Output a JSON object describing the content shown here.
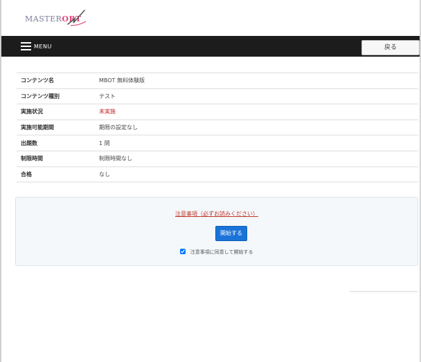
{
  "header": {
    "logo": {
      "text_main": "MASTER",
      "text_accent": "ORT",
      "icon": "swoosh-logo-icon"
    }
  },
  "navbar": {
    "menu_label": "MENU",
    "menu_icon": "hamburger-icon",
    "back_label": "戻る"
  },
  "info": {
    "rows": [
      {
        "label": "コンテンツ名",
        "value": "MBOT 無料体験版"
      },
      {
        "label": "コンテンツ種別",
        "value": "テスト"
      },
      {
        "label": "実施状況",
        "value": "未実施"
      },
      {
        "label": "実施可能期間",
        "value": "期限の設定なし"
      },
      {
        "label": "出題数",
        "value": "1 問"
      },
      {
        "label": "制限時間",
        "value": "制限時間なし"
      },
      {
        "label": "合格",
        "value": "なし"
      }
    ]
  },
  "panel": {
    "notice": "注意事項（必ずお読みください）",
    "start_label": "開始する",
    "agree_label": "注意事項に同意して開始する",
    "agree_checked": true
  },
  "colors": {
    "navbar_bg": "#1c1c1c",
    "accent": "#1a73d9",
    "status_red": "#cc2222",
    "panel_bg": "#f4f8fb"
  }
}
